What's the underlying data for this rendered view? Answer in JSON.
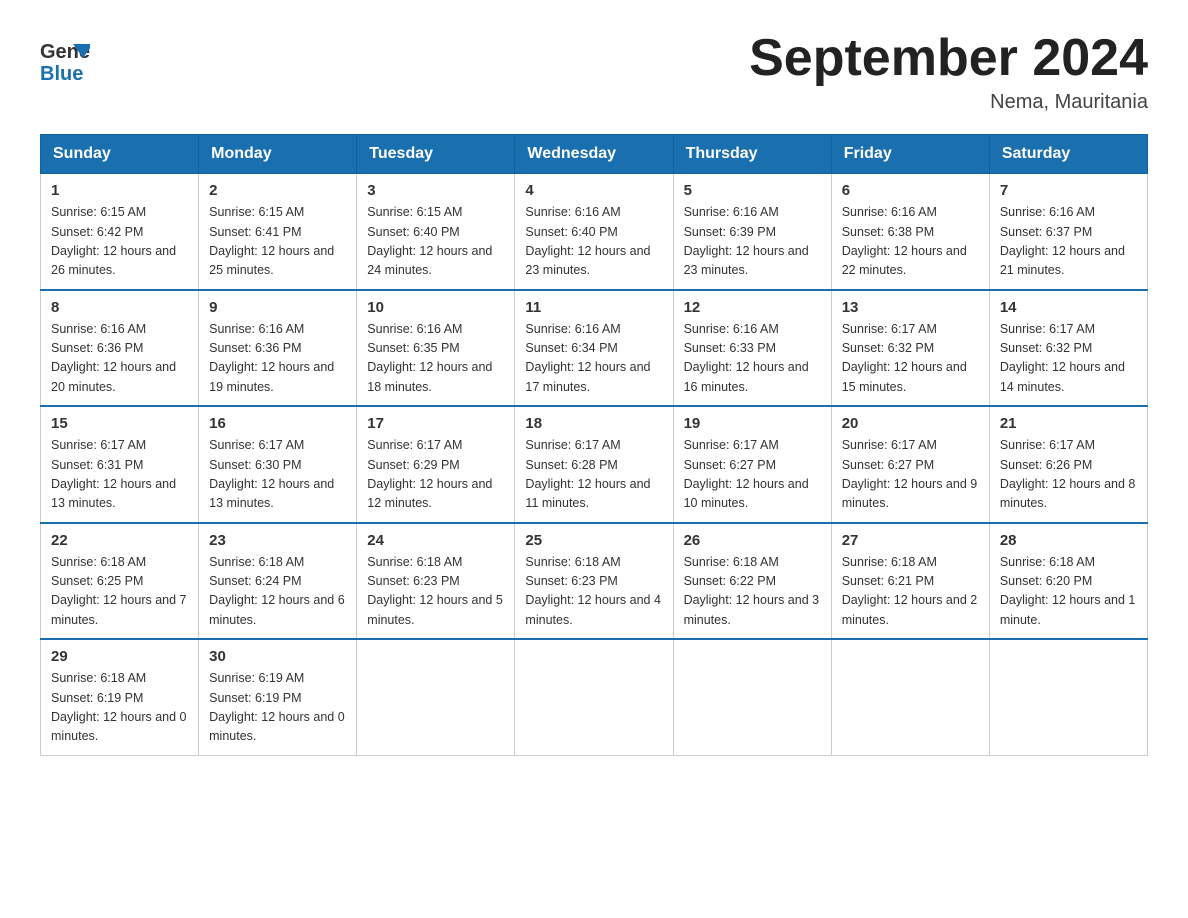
{
  "logo": {
    "text_general": "General",
    "text_blue": "Blue",
    "arrow_color": "#1a6faf"
  },
  "header": {
    "month_title": "September 2024",
    "location": "Nema, Mauritania"
  },
  "days_of_week": [
    "Sunday",
    "Monday",
    "Tuesday",
    "Wednesday",
    "Thursday",
    "Friday",
    "Saturday"
  ],
  "weeks": [
    [
      {
        "day": "1",
        "sunrise": "6:15 AM",
        "sunset": "6:42 PM",
        "daylight": "12 hours and 26 minutes."
      },
      {
        "day": "2",
        "sunrise": "6:15 AM",
        "sunset": "6:41 PM",
        "daylight": "12 hours and 25 minutes."
      },
      {
        "day": "3",
        "sunrise": "6:15 AM",
        "sunset": "6:40 PM",
        "daylight": "12 hours and 24 minutes."
      },
      {
        "day": "4",
        "sunrise": "6:16 AM",
        "sunset": "6:40 PM",
        "daylight": "12 hours and 23 minutes."
      },
      {
        "day": "5",
        "sunrise": "6:16 AM",
        "sunset": "6:39 PM",
        "daylight": "12 hours and 23 minutes."
      },
      {
        "day": "6",
        "sunrise": "6:16 AM",
        "sunset": "6:38 PM",
        "daylight": "12 hours and 22 minutes."
      },
      {
        "day": "7",
        "sunrise": "6:16 AM",
        "sunset": "6:37 PM",
        "daylight": "12 hours and 21 minutes."
      }
    ],
    [
      {
        "day": "8",
        "sunrise": "6:16 AM",
        "sunset": "6:36 PM",
        "daylight": "12 hours and 20 minutes."
      },
      {
        "day": "9",
        "sunrise": "6:16 AM",
        "sunset": "6:36 PM",
        "daylight": "12 hours and 19 minutes."
      },
      {
        "day": "10",
        "sunrise": "6:16 AM",
        "sunset": "6:35 PM",
        "daylight": "12 hours and 18 minutes."
      },
      {
        "day": "11",
        "sunrise": "6:16 AM",
        "sunset": "6:34 PM",
        "daylight": "12 hours and 17 minutes."
      },
      {
        "day": "12",
        "sunrise": "6:16 AM",
        "sunset": "6:33 PM",
        "daylight": "12 hours and 16 minutes."
      },
      {
        "day": "13",
        "sunrise": "6:17 AM",
        "sunset": "6:32 PM",
        "daylight": "12 hours and 15 minutes."
      },
      {
        "day": "14",
        "sunrise": "6:17 AM",
        "sunset": "6:32 PM",
        "daylight": "12 hours and 14 minutes."
      }
    ],
    [
      {
        "day": "15",
        "sunrise": "6:17 AM",
        "sunset": "6:31 PM",
        "daylight": "12 hours and 13 minutes."
      },
      {
        "day": "16",
        "sunrise": "6:17 AM",
        "sunset": "6:30 PM",
        "daylight": "12 hours and 13 minutes."
      },
      {
        "day": "17",
        "sunrise": "6:17 AM",
        "sunset": "6:29 PM",
        "daylight": "12 hours and 12 minutes."
      },
      {
        "day": "18",
        "sunrise": "6:17 AM",
        "sunset": "6:28 PM",
        "daylight": "12 hours and 11 minutes."
      },
      {
        "day": "19",
        "sunrise": "6:17 AM",
        "sunset": "6:27 PM",
        "daylight": "12 hours and 10 minutes."
      },
      {
        "day": "20",
        "sunrise": "6:17 AM",
        "sunset": "6:27 PM",
        "daylight": "12 hours and 9 minutes."
      },
      {
        "day": "21",
        "sunrise": "6:17 AM",
        "sunset": "6:26 PM",
        "daylight": "12 hours and 8 minutes."
      }
    ],
    [
      {
        "day": "22",
        "sunrise": "6:18 AM",
        "sunset": "6:25 PM",
        "daylight": "12 hours and 7 minutes."
      },
      {
        "day": "23",
        "sunrise": "6:18 AM",
        "sunset": "6:24 PM",
        "daylight": "12 hours and 6 minutes."
      },
      {
        "day": "24",
        "sunrise": "6:18 AM",
        "sunset": "6:23 PM",
        "daylight": "12 hours and 5 minutes."
      },
      {
        "day": "25",
        "sunrise": "6:18 AM",
        "sunset": "6:23 PM",
        "daylight": "12 hours and 4 minutes."
      },
      {
        "day": "26",
        "sunrise": "6:18 AM",
        "sunset": "6:22 PM",
        "daylight": "12 hours and 3 minutes."
      },
      {
        "day": "27",
        "sunrise": "6:18 AM",
        "sunset": "6:21 PM",
        "daylight": "12 hours and 2 minutes."
      },
      {
        "day": "28",
        "sunrise": "6:18 AM",
        "sunset": "6:20 PM",
        "daylight": "12 hours and 1 minute."
      }
    ],
    [
      {
        "day": "29",
        "sunrise": "6:18 AM",
        "sunset": "6:19 PM",
        "daylight": "12 hours and 0 minutes."
      },
      {
        "day": "30",
        "sunrise": "6:19 AM",
        "sunset": "6:19 PM",
        "daylight": "12 hours and 0 minutes."
      },
      null,
      null,
      null,
      null,
      null
    ]
  ]
}
